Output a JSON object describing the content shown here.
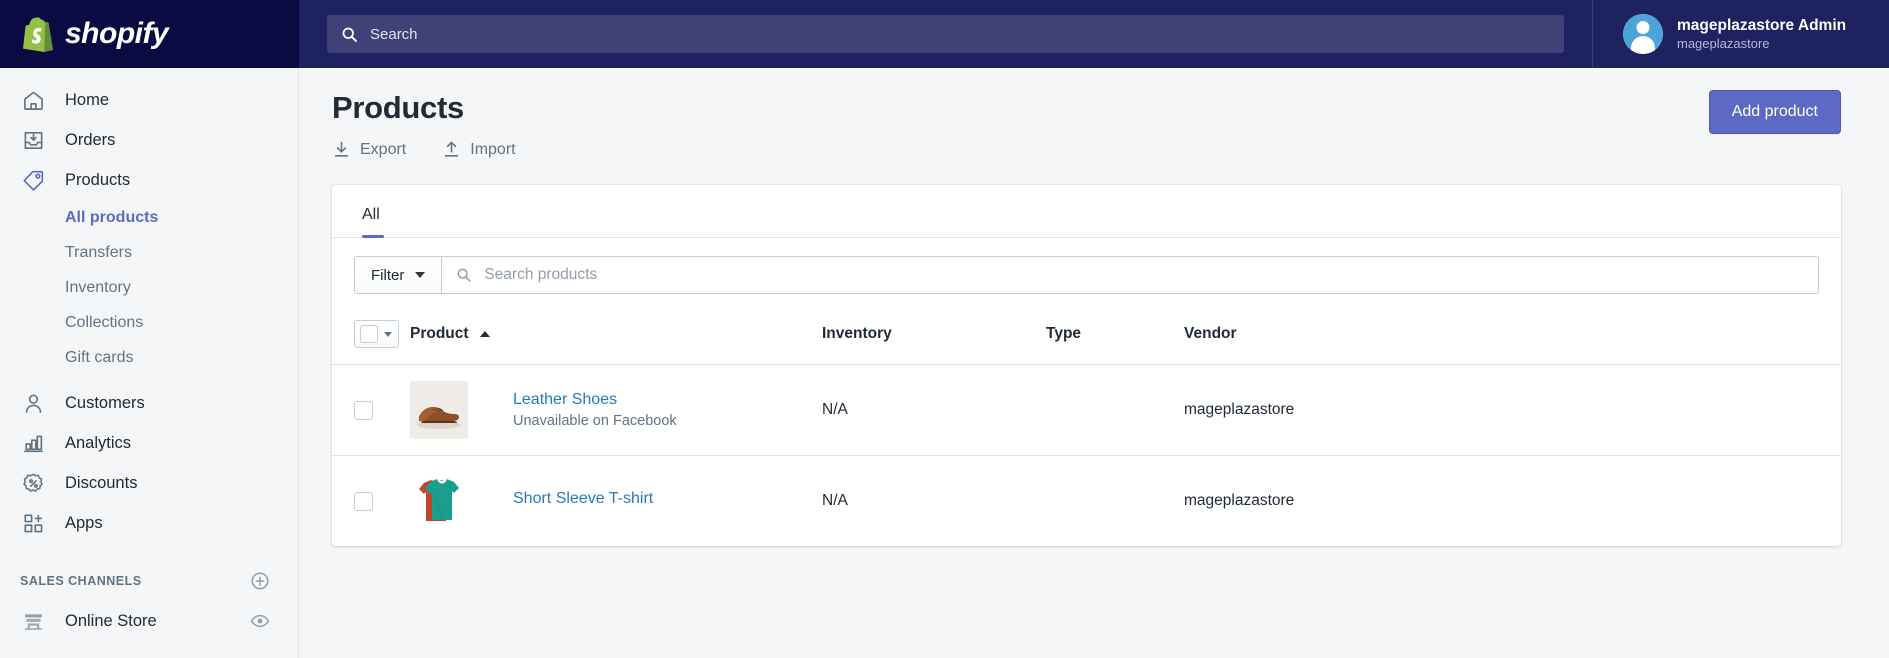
{
  "topbar": {
    "brand": "shopify",
    "brand_icon": "shopify-bag-icon",
    "search": {
      "icon": "search-icon",
      "placeholder": "Search",
      "value": ""
    },
    "user": {
      "avatar_icon": "user-avatar-icon",
      "name": "mageplazastore Admin",
      "store": "mageplazastore"
    },
    "colors": {
      "logo_bg": "#0b0b43",
      "bar_bg": "#1f2260",
      "search_bg": "#3f4177"
    }
  },
  "sidebar": {
    "items": [
      {
        "label": "Home",
        "icon": "home-icon"
      },
      {
        "label": "Orders",
        "icon": "orders-inbox-icon"
      },
      {
        "label": "Products",
        "icon": "products-tag-icon"
      }
    ],
    "sub_items": [
      {
        "label": "All products",
        "active": true
      },
      {
        "label": "Transfers",
        "active": false
      },
      {
        "label": "Inventory",
        "active": false
      },
      {
        "label": "Collections",
        "active": false
      },
      {
        "label": "Gift cards",
        "active": false
      }
    ],
    "items_lower": [
      {
        "label": "Customers",
        "icon": "customer-person-icon"
      },
      {
        "label": "Analytics",
        "icon": "analytics-bars-icon"
      },
      {
        "label": "Discounts",
        "icon": "discount-percent-icon"
      },
      {
        "label": "Apps",
        "icon": "apps-grid-plus-icon"
      }
    ],
    "section": {
      "title": "SALES CHANNELS",
      "add_icon": "plus-circle-icon"
    },
    "channels": [
      {
        "label": "Online Store",
        "icon": "online-store-icon",
        "trailing_icon": "eye-icon"
      }
    ],
    "active_color": "#5c6ac4"
  },
  "main": {
    "title": "Products",
    "actions": [
      {
        "label": "Export",
        "icon": "export-download-icon"
      },
      {
        "label": "Import",
        "icon": "import-upload-icon"
      }
    ],
    "primary_button": {
      "label": "Add product",
      "color": "#5c6ac4"
    },
    "tabs": [
      {
        "label": "All",
        "active": true
      }
    ],
    "filter": {
      "button_label": "Filter",
      "caret_icon": "chevron-down-icon",
      "search_icon": "search-icon",
      "search_placeholder": "Search products",
      "search_value": ""
    },
    "table": {
      "select_all_icon": "select-all-checkbox-icon",
      "headers": {
        "product": "Product",
        "inventory": "Inventory",
        "type": "Type",
        "vendor": "Vendor"
      },
      "sort": {
        "column": "Product",
        "direction": "asc",
        "icon": "caret-up-icon"
      },
      "rows": [
        {
          "checkbox_icon": "row-checkbox-icon",
          "thumbnail_icon": "leather-shoes-thumbnail",
          "name": "Leather Shoes",
          "subtitle": "Unavailable on Facebook",
          "inventory": "N/A",
          "type": "",
          "vendor": "mageplazastore"
        },
        {
          "checkbox_icon": "row-checkbox-icon",
          "thumbnail_icon": "tshirt-thumbnail",
          "name": "Short Sleeve T-shirt",
          "subtitle": "",
          "inventory": "N/A",
          "type": "",
          "vendor": "mageplazastore"
        }
      ]
    }
  }
}
